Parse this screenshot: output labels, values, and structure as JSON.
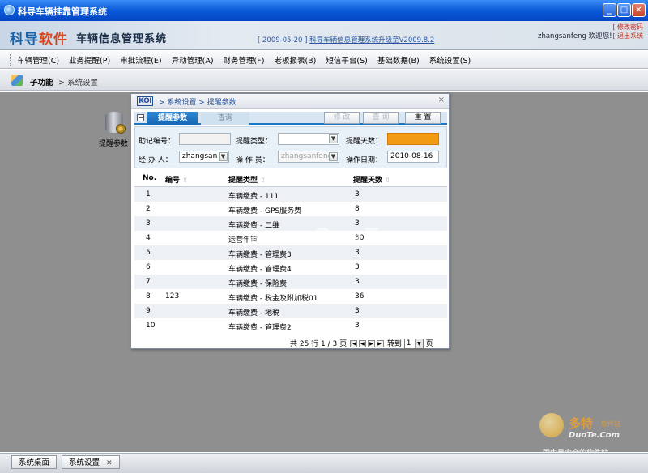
{
  "window": {
    "title": "科导车辆挂靠管理系统",
    "min": "_",
    "max": "□",
    "close": "✕"
  },
  "header": {
    "logo_main": "科导",
    "logo_accent": "软件",
    "system_name": "车辆信息管理系统",
    "notice_date": "[ 2009-05-20 ]",
    "notice_link": "科导车辆信息管理系统升级至V2009.8.2",
    "user_greeting": "zhangsanfeng 欢迎您!",
    "link_1": "[ 修改密码",
    "link_2": "[ 退出系统"
  },
  "menu": [
    "车辆管理(C)",
    "业务提醒(P)",
    "审批流程(E)",
    "异动管理(A)",
    "财务管理(F)",
    "老板报表(B)",
    "短信平台(S)",
    "基础数据(B)",
    "系统设置(S)"
  ],
  "breadcrumb": {
    "root": "子功能",
    "current": "> 系统设置"
  },
  "desktop": {
    "icon_label": "提醒参数"
  },
  "dialog": {
    "logo": "KOI",
    "breadcrumb": "> 系统设置 > 提醒参数",
    "close": "×",
    "tab_toggle": "−",
    "tab_active": "提醒参数",
    "tab_inactive": "查询",
    "btn_modify": "修 改",
    "btn_query": "查 询",
    "btn_reset": "重 置",
    "form": {
      "mnemonic_label": "助记编号：",
      "mnemonic_value": "",
      "type_label": "提醒类型：",
      "type_value": "",
      "days_label": "提醒天数：",
      "handler_label": "经 办 人：",
      "handler_value": "zhangsan",
      "operator_label": "操 作 员：",
      "operator_value": "zhangsanfeng",
      "date_label": "操作日期：",
      "date_value": "2010-08-16"
    },
    "columns": {
      "no": "No.",
      "code": "编号",
      "type": "提醒类型",
      "days": "提醒天数",
      "sort_glyph": "⇧"
    },
    "rows": [
      {
        "no": "1",
        "code": "",
        "type": "车辆缴费 - 111",
        "days": "3"
      },
      {
        "no": "2",
        "code": "",
        "type": "车辆缴费 - GPS服务费",
        "days": "8"
      },
      {
        "no": "3",
        "code": "",
        "type": "车辆缴费 - 二维",
        "days": "3"
      },
      {
        "no": "4",
        "code": "",
        "type": "运营年审",
        "days": "30"
      },
      {
        "no": "5",
        "code": "",
        "type": "车辆缴费 - 管理费3",
        "days": "3"
      },
      {
        "no": "6",
        "code": "",
        "type": "车辆缴费 - 管理费4",
        "days": "3"
      },
      {
        "no": "7",
        "code": "",
        "type": "车辆缴费 - 保险费",
        "days": "3"
      },
      {
        "no": "8",
        "code": "123",
        "type": "车辆缴费 - 税金及附加税01",
        "days": "36"
      },
      {
        "no": "9",
        "code": "",
        "type": "车辆缴费 - 地税",
        "days": "3"
      },
      {
        "no": "10",
        "code": "",
        "type": "车辆缴费 - 管理费2",
        "days": "3"
      }
    ],
    "pager": {
      "summary": "共 25 行 1 / 3 页",
      "goto": "转到",
      "page_value": "1",
      "page_suffix": "页"
    }
  },
  "watermark": {
    "center": "www.DuoTe.com",
    "brand": "多特",
    "brand_sub": "软件站",
    "site": "DuoTe.Com",
    "tagline": "国内最安全的软件站"
  },
  "taskbar": {
    "desktop_tab": "系统桌面",
    "settings_tab": "系统设置",
    "close_glyph": "✕"
  },
  "colors": {
    "title_blue": "#0a5ad8",
    "desktop_gray": "#8f8f8f",
    "tab_active": "#1c77c2",
    "days_field": "#f39a13"
  }
}
